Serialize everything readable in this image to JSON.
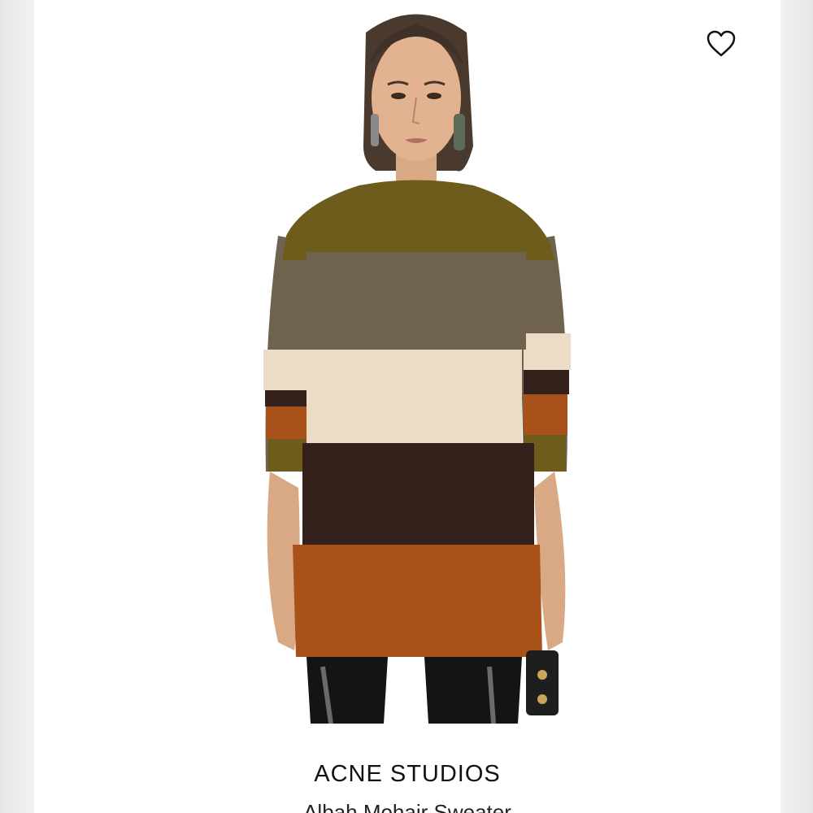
{
  "product": {
    "brand": "ACNE STUDIOS",
    "name": "Albah Mohair Sweater"
  },
  "image": {
    "subject": "product-photo-striped-mohair-sweater"
  },
  "icons": {
    "favorite": "heart-outline-icon"
  },
  "colors": {
    "stripe_olive": "#6e5c1c",
    "stripe_taupe": "#6f6350",
    "stripe_cream": "#ecdcc6",
    "stripe_dark_brown": "#34211c",
    "stripe_orange": "#a8521a"
  }
}
